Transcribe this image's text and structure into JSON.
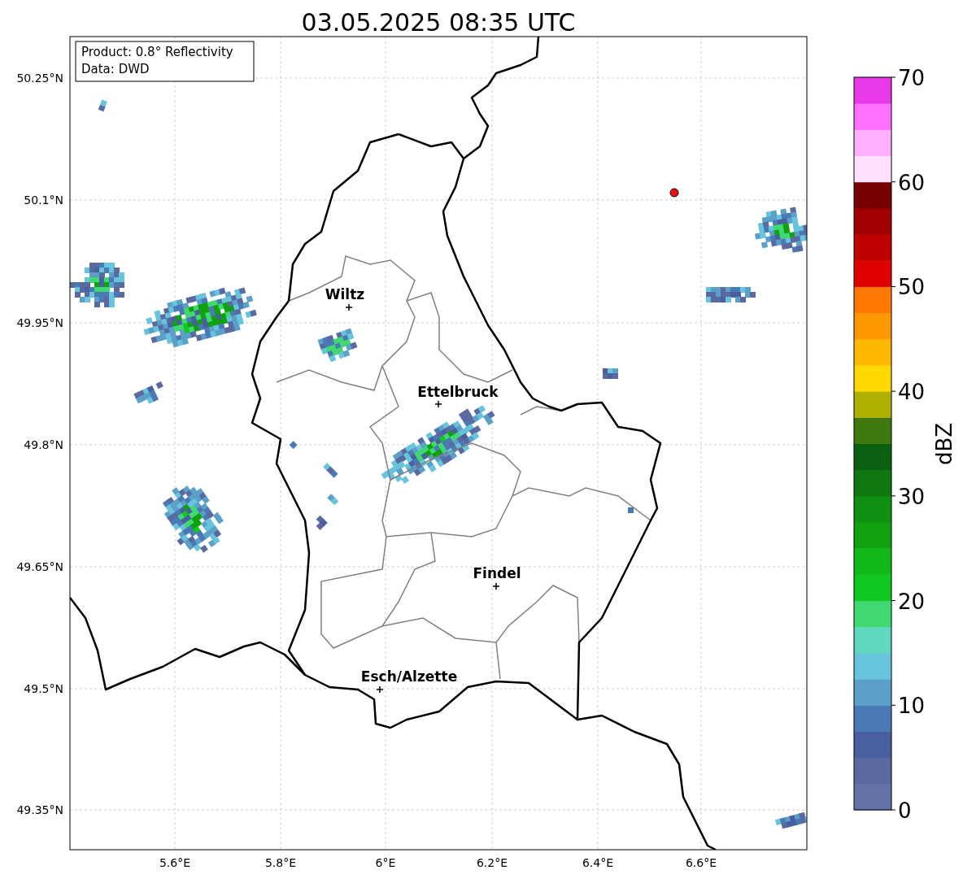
{
  "title": "03.05.2025 08:35 UTC",
  "info_box": {
    "lines": [
      "Product: 0.8° Reflectivity",
      "Data: DWD"
    ]
  },
  "map": {
    "cities": [
      "Wiltz",
      "Ettelbruck",
      "Findel",
      "Esch/Alzette"
    ],
    "lat_ticks": [
      "50.25°N",
      "50.1°N",
      "49.95°N",
      "49.8°N",
      "49.65°N",
      "49.5°N",
      "49.35°N"
    ],
    "lon_ticks": [
      "5.6°E",
      "5.8°E",
      "6°E",
      "6.2°E",
      "6.4°E",
      "6.6°E"
    ]
  },
  "colorbar": {
    "label": "dBZ",
    "ticks": [
      "70",
      "60",
      "50",
      "40",
      "30",
      "20",
      "10",
      "0"
    ],
    "segments": [
      {
        "color": "#6472a8"
      },
      {
        "color": "#5a6aa0"
      },
      {
        "color": "#4a5fa0"
      },
      {
        "color": "#4a7ab5"
      },
      {
        "color": "#5aa0c8"
      },
      {
        "color": "#68c3dd"
      },
      {
        "color": "#60d8c0"
      },
      {
        "color": "#40d870"
      },
      {
        "color": "#10c820"
      },
      {
        "color": "#10b818"
      },
      {
        "color": "#10a010"
      },
      {
        "color": "#109010"
      },
      {
        "color": "#107810"
      },
      {
        "color": "#0a6010"
      },
      {
        "color": "#407810"
      },
      {
        "color": "#b0b000"
      },
      {
        "color": "#ffd800"
      },
      {
        "color": "#ffb800"
      },
      {
        "color": "#ff9800"
      },
      {
        "color": "#ff7800"
      },
      {
        "color": "#e00000"
      },
      {
        "color": "#c00000"
      },
      {
        "color": "#a00000"
      },
      {
        "color": "#780000"
      },
      {
        "color": "#ffe0ff"
      },
      {
        "color": "#ffb0ff"
      },
      {
        "color": "#ff70ff"
      },
      {
        "color": "#e838e8"
      }
    ]
  }
}
